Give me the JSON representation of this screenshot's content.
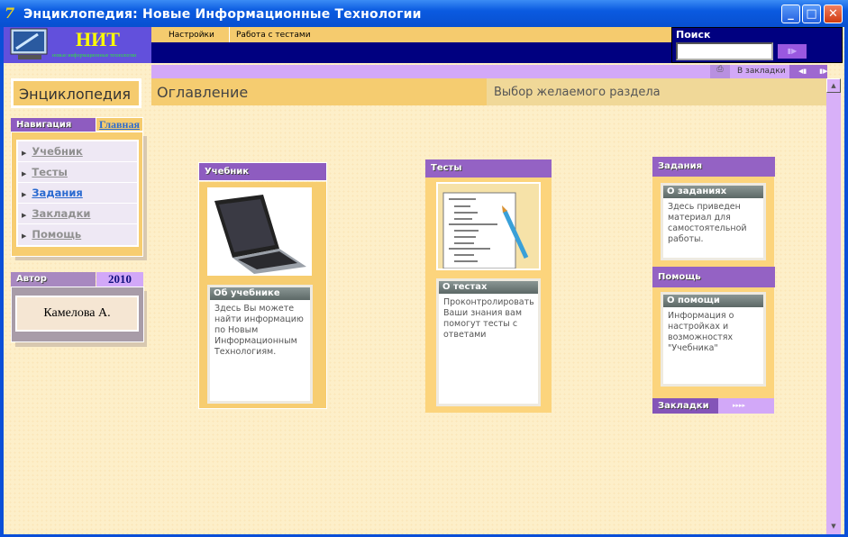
{
  "window": {
    "title": "Энциклопедия: Новые Информационные Технологии",
    "icon": "app-logo-icon"
  },
  "logo": {
    "title": "НИТ",
    "subtitle": "новые информационные технологии"
  },
  "menu": [
    "Настройки",
    "Работа с тестами"
  ],
  "search": {
    "label": "Поиск",
    "value": "",
    "button": "arrow-right-icon"
  },
  "toolbar": {
    "print_icon": "printer-icon",
    "bookmark": "В закладки",
    "prev_icon": "prev-icon",
    "next_icon": "next-icon"
  },
  "sidebar": {
    "title": "Энциклопедия",
    "nav_header": "Навигация",
    "home_link": "Главная",
    "nav_items": [
      {
        "label": "Учебник"
      },
      {
        "label": "Тесты"
      },
      {
        "label": "Задания",
        "active": true
      },
      {
        "label": "Закладки"
      },
      {
        "label": "Помощь"
      }
    ],
    "author_header": "Автор",
    "year": "2010",
    "author": "Камелова А."
  },
  "main": {
    "title": "Оглавление",
    "subtitle": "Выбор желаемого раздела"
  },
  "cards": [
    {
      "title": "Учебник",
      "image": "laptop-image",
      "box_title": "Об учебнике",
      "text": "Здесь Вы можете найти информацию по Новым Информационным Технологиям."
    },
    {
      "title": "Тесты",
      "image": "test-sheet-image",
      "box_title": "О тестах",
      "text": "Проконтролировать Ваши знания вам помогут тесты с ответами"
    },
    {
      "title": "Задания",
      "box_title": "О заданиях",
      "text": "Здесь приведен материал для самостоятельной работы."
    },
    {
      "title": "Помощь",
      "box_title": "О помощи",
      "text": "Информация о настройках и возможностях \"Учебника\""
    }
  ],
  "bookmarks": {
    "label": "Закладки",
    "arrows": "▸▸▸▸"
  },
  "colors": {
    "purple": "#8e5cc0",
    "lavender": "#d2a8f8",
    "yellow": "#f5cb6e",
    "navy": "#000080",
    "link_active": "#2a6ad0"
  }
}
